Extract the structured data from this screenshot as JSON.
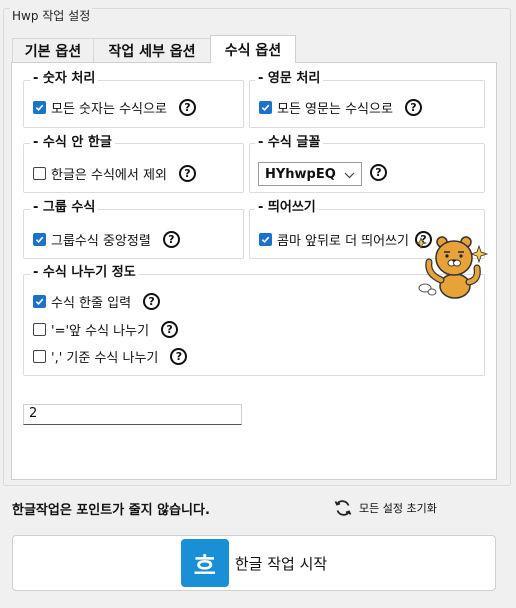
{
  "window": {
    "group_title": "Hwp 작업 설정"
  },
  "tabs": [
    {
      "label": "기본 옵션",
      "active": false
    },
    {
      "label": "작업 세부 옵션",
      "active": false
    },
    {
      "label": "수식 옵션",
      "active": true
    }
  ],
  "number_group": {
    "title": "숫자 처리",
    "option_label": "모든 숫자는 수식으로",
    "checked": true
  },
  "english_group": {
    "title": "영문 처리",
    "option_label": "모든 영문는 수식으로",
    "checked": true
  },
  "hangul_group": {
    "title": "수식 안 한글",
    "option_label": "한글은 수식에서 제외",
    "checked": false
  },
  "font_group": {
    "title": "수식 글꼴",
    "selected_font": "HYhwpEQ"
  },
  "group_group": {
    "title": "그룹 수식",
    "option_label": "그룹수식 중앙정렬",
    "checked": true
  },
  "spacing_group": {
    "title": "띄어쓰기",
    "option_label": "콤마 앞뒤로 더 띄어쓰기",
    "checked": true
  },
  "split_group": {
    "title": "수식 나누기 정도",
    "options": [
      {
        "label": "수식 한줄 입력",
        "checked": true
      },
      {
        "label": "'='앞 수식 나누기",
        "checked": false
      },
      {
        "label": "',' 기준 수식 나누기",
        "checked": false
      }
    ]
  },
  "value_input": {
    "value": "2"
  },
  "footer": {
    "notice": "한글작업은 포인트가 줄지 않습니다.",
    "reset_label": "모든 설정 초기화",
    "start_label": "한글 작업 시작",
    "logo_char": "흐"
  },
  "help_glyph": "?",
  "colors": {
    "checkbox_accent": "#1a73c8",
    "hangul_logo": "#1a8fd6",
    "mascot": "#e8a23a"
  },
  "icons": {
    "help": "question-circle-icon",
    "reset": "refresh-icon",
    "dropdown": "chevron-down-icon",
    "mascot": "ryan-character-icon"
  }
}
